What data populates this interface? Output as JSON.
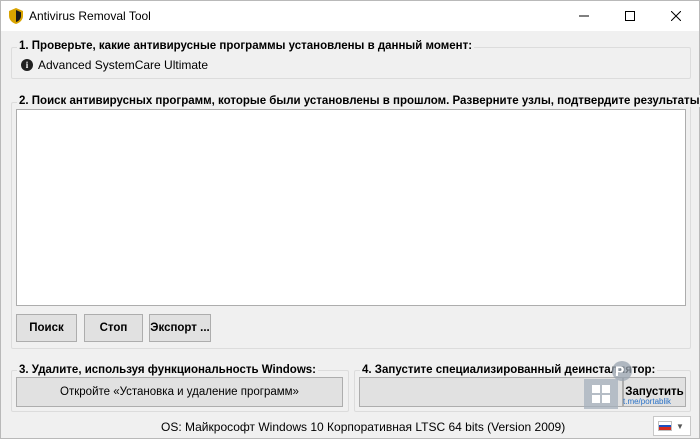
{
  "window": {
    "title": "Antivirus Removal Tool",
    "minimize_icon": "minimize-icon",
    "maximize_icon": "maximize-icon",
    "close_icon": "close-icon"
  },
  "section1": {
    "title": "1. Проверьте, какие антивирусные программы установлены в данный момент:",
    "items": [
      {
        "icon": "info-icon",
        "label": "Advanced SystemCare Ultimate"
      }
    ]
  },
  "section2": {
    "title": "2. Поиск антивирусных программ, которые были установлены в прошлом. Разверните узлы, подтвердите результаты:",
    "search_label": "Поиск",
    "stop_label": "Стоп",
    "export_label": "Экспорт ..."
  },
  "section3": {
    "title": "3. Удалите, используя функциональность Windows:",
    "button_label": "Откройте «Установка и удаление программ»"
  },
  "section4": {
    "title": "4. Запустите специализированный деинсталлятор:",
    "combo_value": "",
    "run_label": "Запустить"
  },
  "watermark": {
    "link": "t.me/portablik"
  },
  "status": {
    "os_text": "OS: Майкрософт Windows 10 Корпоративная LTSC 64 bits (Version 2009)"
  },
  "language": {
    "flag": "russia-flag-icon"
  },
  "colors": {
    "window_bg": "#f0f0f0",
    "button_bg": "#e1e1e1",
    "watermark_blue": "#2a72c8"
  }
}
